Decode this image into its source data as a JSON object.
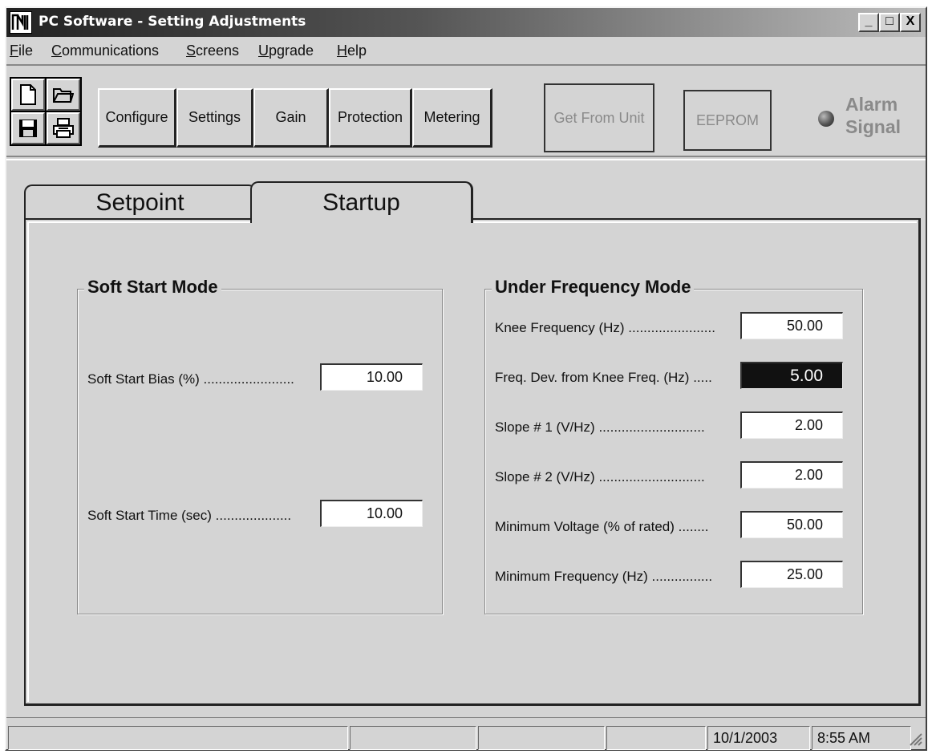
{
  "window": {
    "title": "PC Software - Setting Adjustments",
    "controls": {
      "minimize": "_",
      "maximize": "□",
      "close": "X"
    }
  },
  "menu": [
    {
      "accel": "F",
      "rest": "ile"
    },
    {
      "accel": "C",
      "rest": "ommunications"
    },
    {
      "accel": "S",
      "rest": "creens"
    },
    {
      "accel": "U",
      "rest": "pgrade"
    },
    {
      "accel": "H",
      "rest": "elp"
    }
  ],
  "toolbar": {
    "icons": [
      "new-file-icon",
      "open-folder-icon",
      "save-disk-icon",
      "print-icon"
    ],
    "buttons": [
      "Configure",
      "Settings",
      "Gain",
      "Protection",
      "Metering"
    ],
    "get_from_unit": "Get From Unit",
    "eeprom": "EEPROM",
    "alarm": "Alarm\nSignal"
  },
  "tabs": {
    "setpoint": "Setpoint",
    "startup": "Startup",
    "active": "Startup"
  },
  "soft_start": {
    "title": "Soft Start Mode",
    "bias_label": "Soft Start Bias (%) ........................",
    "bias_value": "10.00",
    "time_label": "Soft Start Time (sec) ....................",
    "time_value": "10.00"
  },
  "under_frequency": {
    "title": "Under Frequency Mode",
    "fields": [
      {
        "label": "Knee Frequency (Hz) .......................",
        "value": "50.00"
      },
      {
        "label": "Freq. Dev. from Knee Freq. (Hz) .....",
        "value": "5.00",
        "selected": true
      },
      {
        "label": "Slope # 1 (V/Hz) ............................",
        "value": "2.00"
      },
      {
        "label": "Slope # 2 (V/Hz) ............................",
        "value": "2.00"
      },
      {
        "label": "Minimum Voltage (% of rated) ........",
        "value": "50.00"
      },
      {
        "label": "Minimum Frequency (Hz) ................",
        "value": "25.00"
      }
    ]
  },
  "status": {
    "date": "10/1/2003",
    "time": "8:55 AM"
  }
}
